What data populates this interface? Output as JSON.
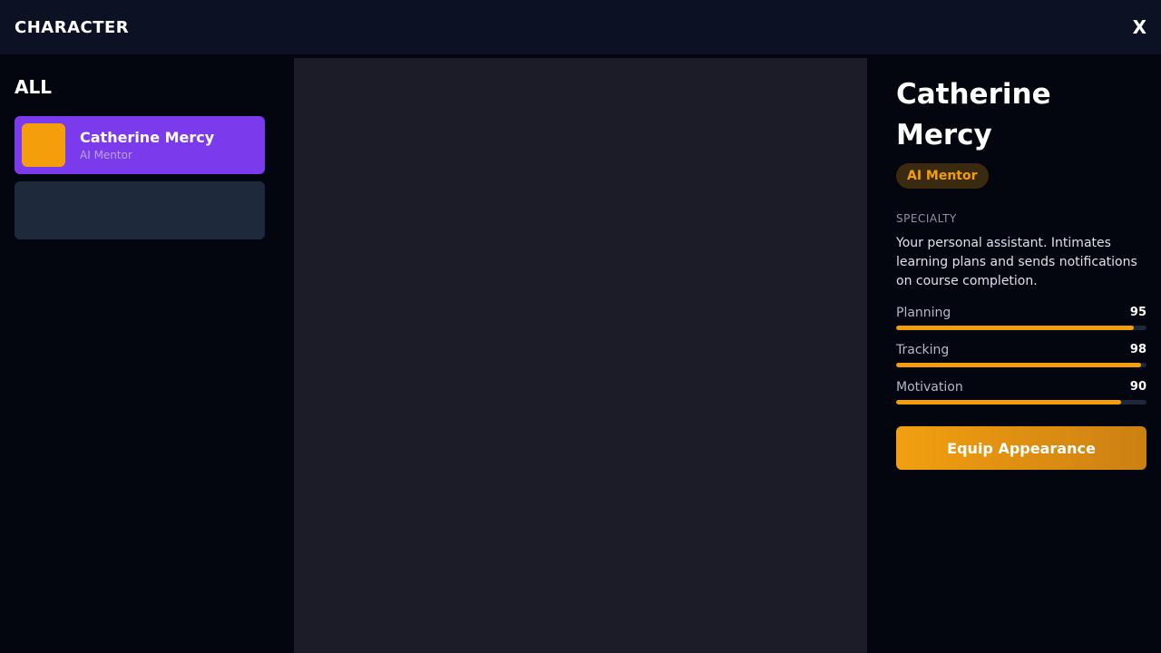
{
  "header": {
    "title": "CHARACTER",
    "close_label": "X"
  },
  "sidebar": {
    "filter_title": "ALL",
    "characters": [
      {
        "name": "Catherine Mercy",
        "role": "AI Mentor",
        "selected": true
      }
    ]
  },
  "detail": {
    "name": "Catherine Mercy",
    "role_badge": "AI Mentor",
    "specialty_label": "SPECIALTY",
    "specialty_text": "Your personal assistant. Intimates learning plans and sends notifications on course completion.",
    "stats": [
      {
        "label": "Planning",
        "value": 95
      },
      {
        "label": "Tracking",
        "value": 98
      },
      {
        "label": "Motivation",
        "value": 90
      }
    ],
    "equip_label": "Equip Appearance"
  },
  "colors": {
    "accent": "#f59e0b",
    "selected_card": "#7c3aed",
    "empty_card": "#1e293b",
    "preview_bg": "#1c1b28"
  }
}
